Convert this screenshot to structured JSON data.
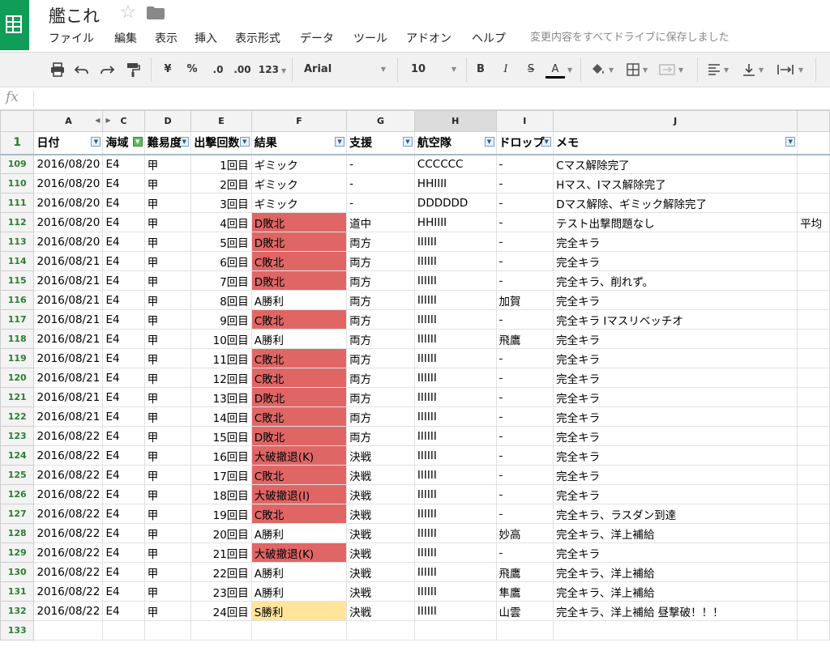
{
  "app": {
    "doc_title": "艦これ",
    "save_status": "変更内容をすべてドライブに保存しました",
    "menu": [
      "ファイル",
      "編集",
      "表示",
      "挿入",
      "表示形式",
      "データ",
      "ツール",
      "アドオン",
      "ヘルプ"
    ]
  },
  "toolbar": {
    "currency": "¥",
    "percent": "%",
    "dec_less": ".0",
    "dec_more": ".00",
    "format_more": "123",
    "font": "Arial",
    "font_size": "10",
    "bold": "B",
    "italic": "I",
    "strike": "S",
    "text_color": "A"
  },
  "formula_bar": {
    "fx": "fx",
    "value": ""
  },
  "columns": [
    "A",
    "C",
    "D",
    "E",
    "F",
    "G",
    "H",
    "I",
    "J"
  ],
  "selected_column": "H",
  "header_row": {
    "row_number": "1",
    "cells": [
      "日付",
      "海域",
      "難易度",
      "出撃回数",
      "結果",
      "支援",
      "航空隊",
      "ドロップ",
      "メモ"
    ]
  },
  "rows": [
    {
      "n": "109",
      "date": "2016/08/20",
      "area": "E4",
      "diff": "甲",
      "sortie": "1回目",
      "result": "ギミック",
      "result_color": "",
      "support": "-",
      "air": "CCCCCC",
      "drop": "-",
      "memo": "Cマス解除完了"
    },
    {
      "n": "110",
      "date": "2016/08/20",
      "area": "E4",
      "diff": "甲",
      "sortie": "2回目",
      "result": "ギミック",
      "result_color": "",
      "support": "-",
      "air": "HHIIII",
      "drop": "-",
      "memo": "Hマス、Iマス解除完了"
    },
    {
      "n": "111",
      "date": "2016/08/20",
      "area": "E4",
      "diff": "甲",
      "sortie": "3回目",
      "result": "ギミック",
      "result_color": "",
      "support": "-",
      "air": "DDDDDD",
      "drop": "-",
      "memo": "Dマス解除、ギミック解除完了"
    },
    {
      "n": "112",
      "date": "2016/08/20",
      "area": "E4",
      "diff": "甲",
      "sortie": "4回目",
      "result": "D敗北",
      "result_color": "red",
      "support": "道中",
      "air": "HHIIII",
      "drop": "-",
      "memo": "テスト出撃問題なし",
      "extra": "平均"
    },
    {
      "n": "113",
      "date": "2016/08/20",
      "area": "E4",
      "diff": "甲",
      "sortie": "5回目",
      "result": "D敗北",
      "result_color": "red",
      "support": "両方",
      "air": "IIIIII",
      "drop": "-",
      "memo": "完全キラ"
    },
    {
      "n": "114",
      "date": "2016/08/21",
      "area": "E4",
      "diff": "甲",
      "sortie": "6回目",
      "result": "C敗北",
      "result_color": "red",
      "support": "両方",
      "air": "IIIIII",
      "drop": "-",
      "memo": "完全キラ"
    },
    {
      "n": "115",
      "date": "2016/08/21",
      "area": "E4",
      "diff": "甲",
      "sortie": "7回目",
      "result": "D敗北",
      "result_color": "red",
      "support": "両方",
      "air": "IIIIII",
      "drop": "-",
      "memo": "完全キラ、削れず。"
    },
    {
      "n": "116",
      "date": "2016/08/21",
      "area": "E4",
      "diff": "甲",
      "sortie": "8回目",
      "result": "A勝利",
      "result_color": "",
      "support": "両方",
      "air": "IIIIII",
      "drop": "加賀",
      "memo": "完全キラ"
    },
    {
      "n": "117",
      "date": "2016/08/21",
      "area": "E4",
      "diff": "甲",
      "sortie": "9回目",
      "result": "C敗北",
      "result_color": "red",
      "support": "両方",
      "air": "IIIIII",
      "drop": "-",
      "memo": "完全キラ Iマスリベッチオ"
    },
    {
      "n": "118",
      "date": "2016/08/21",
      "area": "E4",
      "diff": "甲",
      "sortie": "10回目",
      "result": "A勝利",
      "result_color": "",
      "support": "両方",
      "air": "IIIIII",
      "drop": "飛鷹",
      "memo": "完全キラ"
    },
    {
      "n": "119",
      "date": "2016/08/21",
      "area": "E4",
      "diff": "甲",
      "sortie": "11回目",
      "result": "C敗北",
      "result_color": "red",
      "support": "両方",
      "air": "IIIIII",
      "drop": "-",
      "memo": "完全キラ"
    },
    {
      "n": "120",
      "date": "2016/08/21",
      "area": "E4",
      "diff": "甲",
      "sortie": "12回目",
      "result": "C敗北",
      "result_color": "red",
      "support": "両方",
      "air": "IIIIII",
      "drop": "-",
      "memo": "完全キラ"
    },
    {
      "n": "121",
      "date": "2016/08/21",
      "area": "E4",
      "diff": "甲",
      "sortie": "13回目",
      "result": "D敗北",
      "result_color": "red",
      "support": "両方",
      "air": "IIIIII",
      "drop": "-",
      "memo": "完全キラ"
    },
    {
      "n": "122",
      "date": "2016/08/21",
      "area": "E4",
      "diff": "甲",
      "sortie": "14回目",
      "result": "C敗北",
      "result_color": "red",
      "support": "両方",
      "air": "IIIIII",
      "drop": "-",
      "memo": "完全キラ"
    },
    {
      "n": "123",
      "date": "2016/08/22",
      "area": "E4",
      "diff": "甲",
      "sortie": "15回目",
      "result": "D敗北",
      "result_color": "red",
      "support": "両方",
      "air": "IIIIII",
      "drop": "-",
      "memo": "完全キラ"
    },
    {
      "n": "124",
      "date": "2016/08/22",
      "area": "E4",
      "diff": "甲",
      "sortie": "16回目",
      "result": "大破撤退(K)",
      "result_color": "red",
      "support": "決戦",
      "air": "IIIIII",
      "drop": "-",
      "memo": "完全キラ"
    },
    {
      "n": "125",
      "date": "2016/08/22",
      "area": "E4",
      "diff": "甲",
      "sortie": "17回目",
      "result": "C敗北",
      "result_color": "red",
      "support": "決戦",
      "air": "IIIIII",
      "drop": "-",
      "memo": "完全キラ"
    },
    {
      "n": "126",
      "date": "2016/08/22",
      "area": "E4",
      "diff": "甲",
      "sortie": "18回目",
      "result": "大破撤退(I)",
      "result_color": "red",
      "support": "決戦",
      "air": "IIIIII",
      "drop": "-",
      "memo": "完全キラ"
    },
    {
      "n": "127",
      "date": "2016/08/22",
      "area": "E4",
      "diff": "甲",
      "sortie": "19回目",
      "result": "C敗北",
      "result_color": "red",
      "support": "決戦",
      "air": "IIIIII",
      "drop": "-",
      "memo": "完全キラ、ラスダン到達"
    },
    {
      "n": "128",
      "date": "2016/08/22",
      "area": "E4",
      "diff": "甲",
      "sortie": "20回目",
      "result": "A勝利",
      "result_color": "",
      "support": "決戦",
      "air": "IIIIII",
      "drop": "妙高",
      "memo": "完全キラ、洋上補給"
    },
    {
      "n": "129",
      "date": "2016/08/22",
      "area": "E4",
      "diff": "甲",
      "sortie": "21回目",
      "result": "大破撤退(K)",
      "result_color": "red",
      "support": "決戦",
      "air": "IIIIII",
      "drop": "-",
      "memo": "完全キラ"
    },
    {
      "n": "130",
      "date": "2016/08/22",
      "area": "E4",
      "diff": "甲",
      "sortie": "22回目",
      "result": "A勝利",
      "result_color": "",
      "support": "決戦",
      "air": "IIIIII",
      "drop": "飛鷹",
      "memo": "完全キラ、洋上補給"
    },
    {
      "n": "131",
      "date": "2016/08/22",
      "area": "E4",
      "diff": "甲",
      "sortie": "23回目",
      "result": "A勝利",
      "result_color": "",
      "support": "決戦",
      "air": "IIIIII",
      "drop": "隼鷹",
      "memo": "完全キラ、洋上補給"
    },
    {
      "n": "132",
      "date": "2016/08/22",
      "area": "E4",
      "diff": "甲",
      "sortie": "24回目",
      "result": "S勝利",
      "result_color": "gold",
      "support": "決戦",
      "air": "IIIIII",
      "drop": "山雲",
      "memo": "完全キラ、洋上補給 昼撃破！！！"
    },
    {
      "n": "133",
      "date": "",
      "area": "",
      "diff": "",
      "sortie": "",
      "result": "",
      "result_color": "",
      "support": "",
      "air": "",
      "drop": "",
      "memo": ""
    }
  ],
  "colors": {
    "sheets_green": "#0f9d58",
    "result_red": "#e06666",
    "result_gold": "#ffe599",
    "row_number_green": "#2e7d32"
  }
}
